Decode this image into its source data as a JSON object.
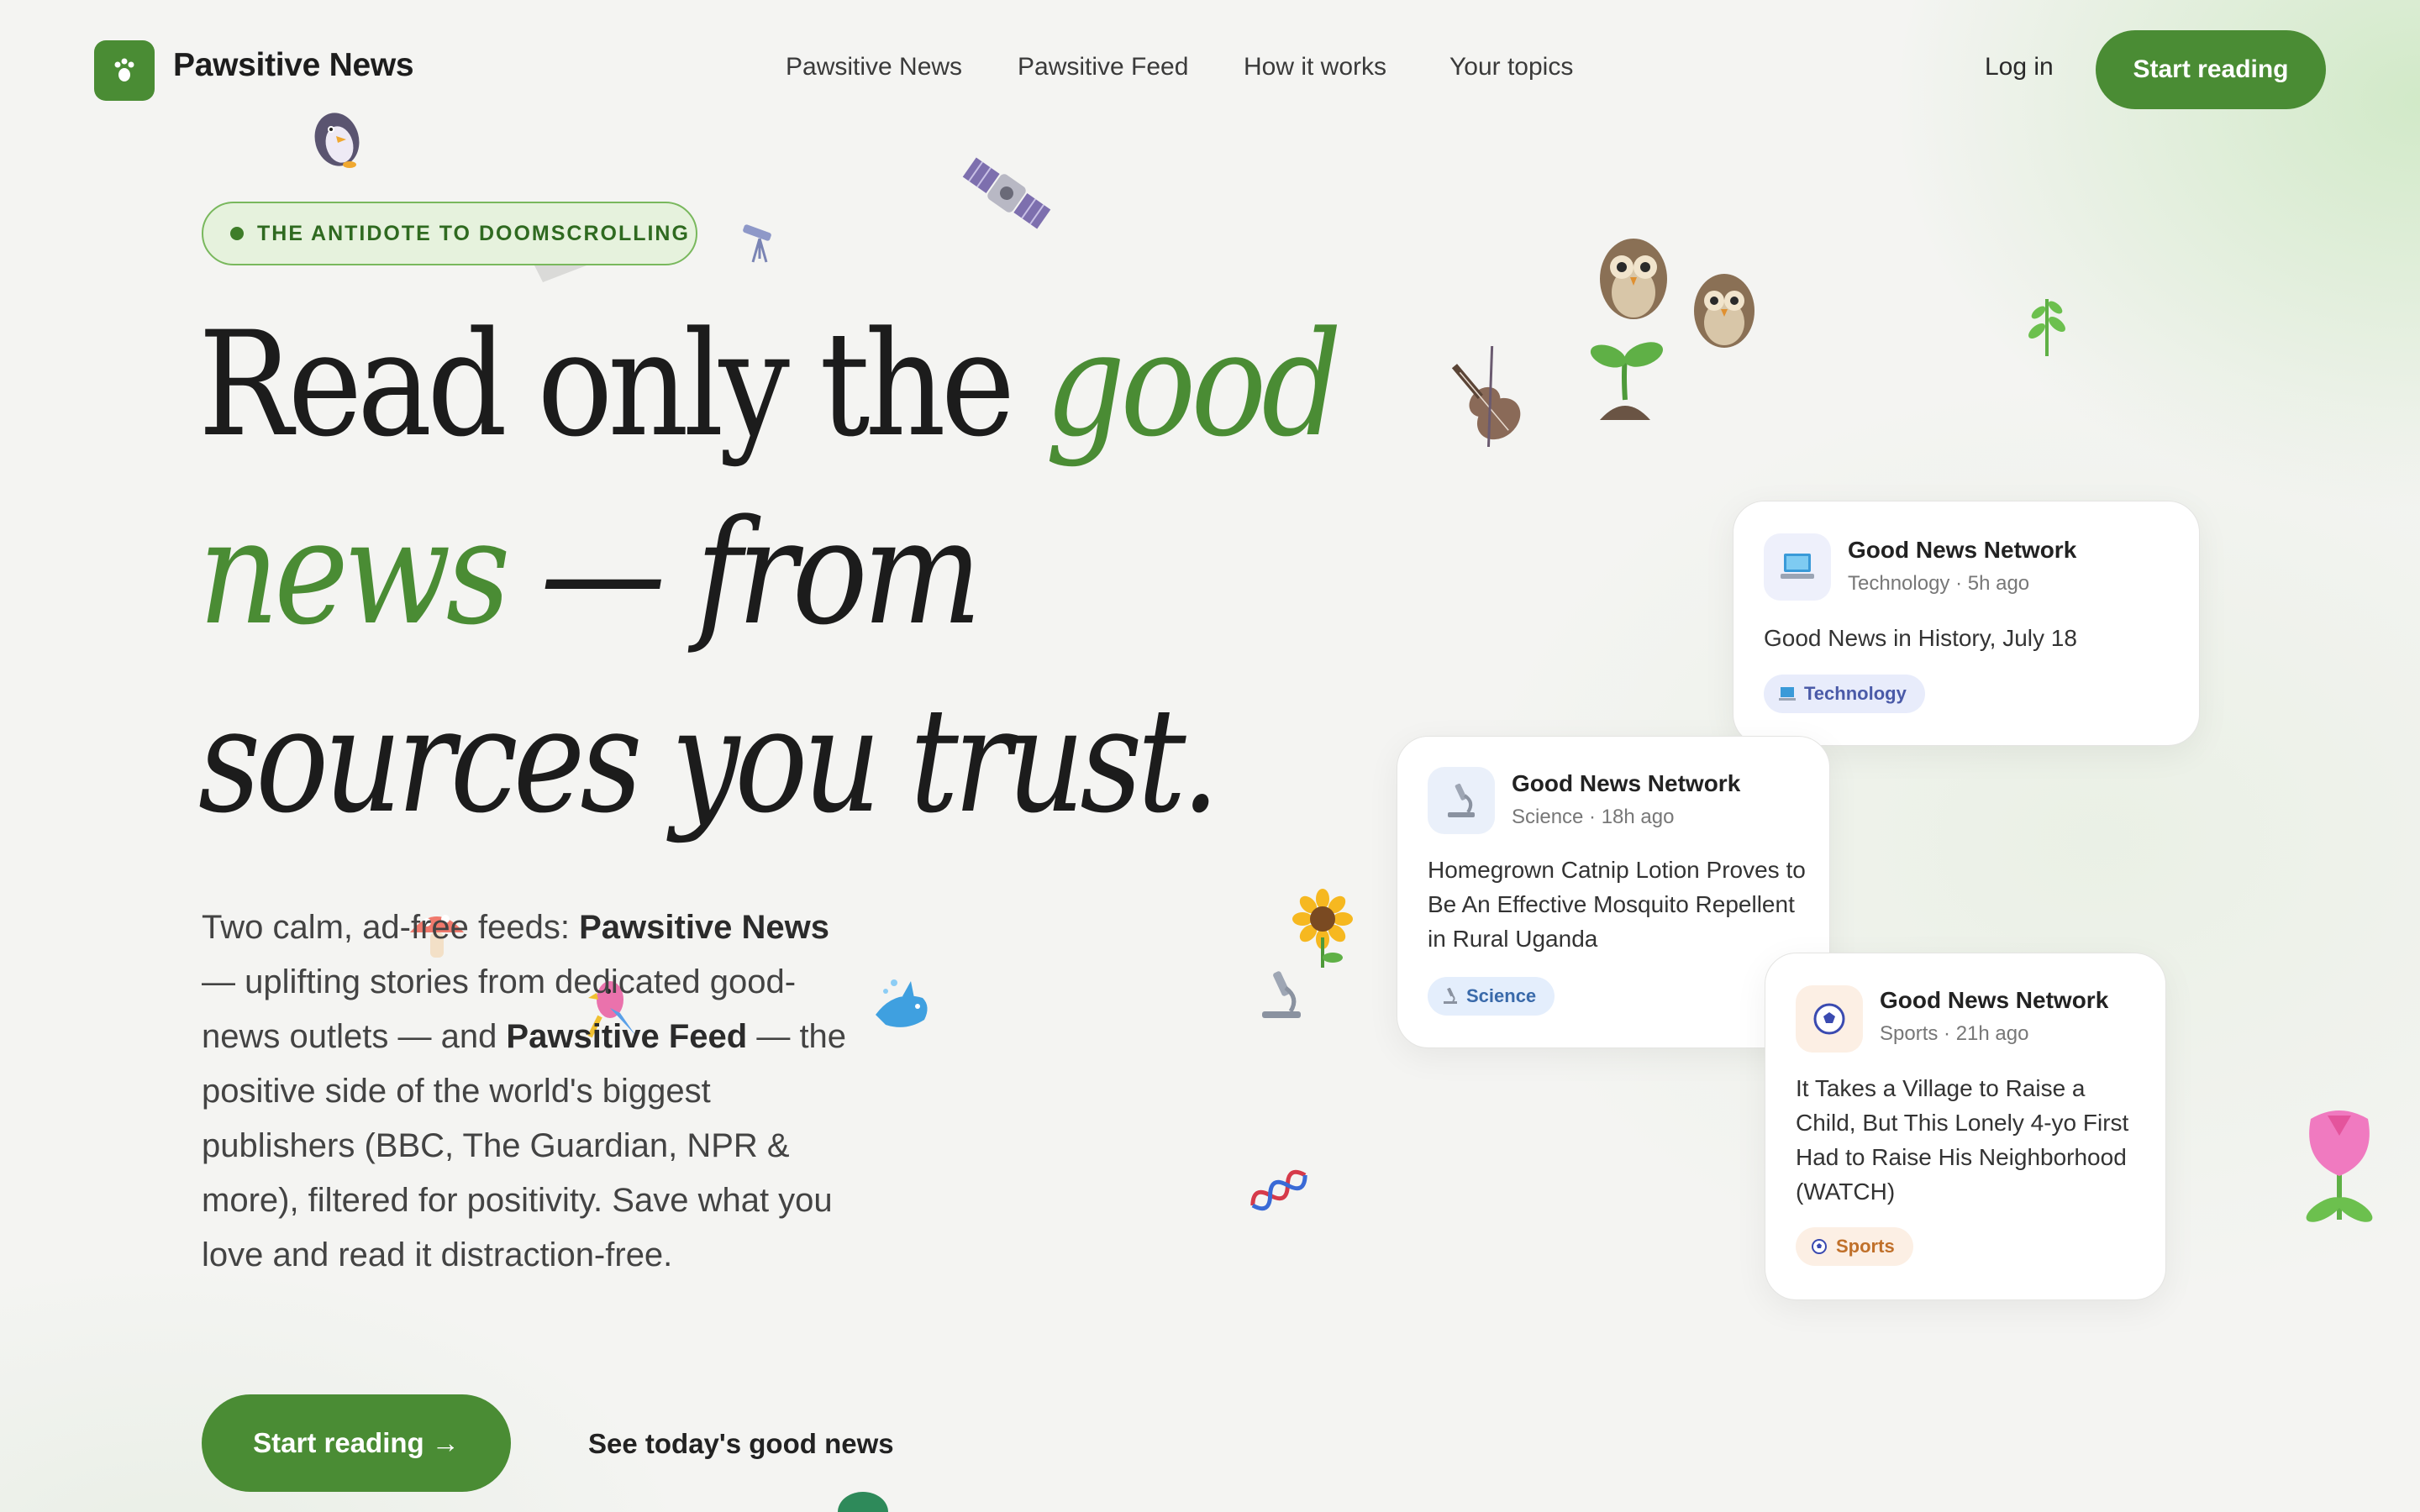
{
  "header": {
    "brand": "Pawsitive News",
    "nav": [
      "Pawsitive News",
      "Pawsitive Feed",
      "How it works",
      "Your topics"
    ],
    "login": "Log in",
    "cta": "Start reading"
  },
  "hero": {
    "badge": "THE ANTIDOTE TO DOOMSCROLLING",
    "headline": {
      "part1": "Read only the ",
      "good": "good",
      "news": "news",
      "part2": " — from",
      "part3": "sources you trust."
    },
    "paragraph": {
      "t1": "Two calm, ad-free feeds: ",
      "b1": "Pawsitive News",
      "t2": " — uplifting stories from dedicated good-news outlets — and ",
      "b2": "Pawsitive Feed",
      "t3": " — the positive side of the world's biggest publishers (BBC, The Guardian, NPR & more), filtered for positivity. Save what you love and read it distraction-free."
    },
    "primary_cta": "Start reading →",
    "secondary_cta": "See today's good news"
  },
  "cards": [
    {
      "source": "Good News Network",
      "meta": "Technology · 5h ago",
      "title": "Good News in History, July 18",
      "tag": "Technology",
      "icon": "laptop-icon"
    },
    {
      "source": "Good News Network",
      "meta": "Science · 18h ago",
      "title": "Homegrown Catnip Lotion Proves to Be An Effective Mosquito Repellent in Rural Uganda",
      "tag": "Science",
      "icon": "microscope-icon"
    },
    {
      "source": "Good News Network",
      "meta": "Sports · 21h ago",
      "title": "It Takes a Village to Raise a Child, But This Lonely 4-yo First Had to Raise His Neighborhood (WATCH)",
      "tag": "Sports",
      "icon": "soccer-ball-icon"
    }
  ],
  "colors": {
    "brand_green": "#4a8c34",
    "background": "#f4f4f2",
    "tech_chip": "#e8ecfb",
    "science_chip": "#e4eefc",
    "sports_chip": "#fcefe4"
  },
  "decorations": [
    "penguin-icon",
    "satellite-icon",
    "telescope-icon",
    "owl-icon",
    "violin-icon",
    "seedling-icon",
    "herb-icon",
    "sunflower-icon",
    "microscope-icon",
    "mushroom-icon",
    "parrot-icon",
    "dolphin-icon",
    "dna-icon",
    "tulip-icon",
    "turtle-icon"
  ]
}
